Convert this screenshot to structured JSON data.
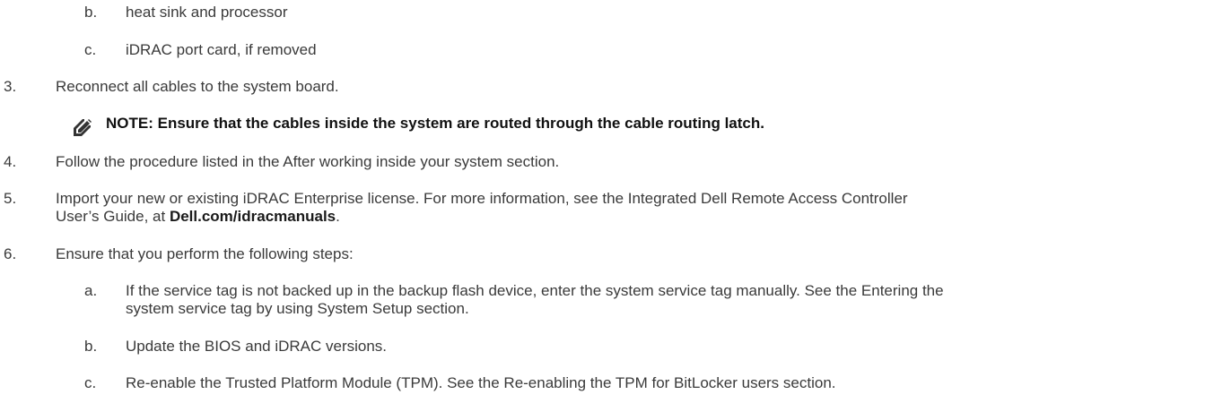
{
  "list": {
    "item2_subs": [
      {
        "marker": "b.",
        "text": "heat sink and processor"
      },
      {
        "marker": "c.",
        "text": "iDRAC port card, if removed"
      }
    ],
    "item3": {
      "marker": "3.",
      "text": "Reconnect all cables to the system board."
    },
    "note": {
      "icon": "pencil-note-icon",
      "text": "NOTE: Ensure that the cables inside the system are routed through the cable routing latch."
    },
    "item4": {
      "marker": "4.",
      "text": "Follow the procedure listed in the After working inside your system section."
    },
    "item5": {
      "marker": "5.",
      "line1": "Import your new or existing iDRAC Enterprise license. For more information, see the Integrated Dell Remote Access Controller",
      "line2_prefix": "User’s Guide, at ",
      "link": "Dell.com/idracmanuals",
      "line2_suffix": "."
    },
    "item6": {
      "marker": "6.",
      "text": "Ensure that you perform the following steps:",
      "subs": [
        {
          "marker": "a.",
          "line1": "If the service tag is not backed up in the backup flash device, enter the system service tag manually. See the Entering the",
          "line2": "system service tag by using System Setup section."
        },
        {
          "marker": "b.",
          "line1": "Update the BIOS and iDRAC versions."
        },
        {
          "marker": "c.",
          "line1": "Re-enable the Trusted Platform Module (TPM). See the Re-enabling the TPM for BitLocker users section."
        }
      ]
    }
  }
}
